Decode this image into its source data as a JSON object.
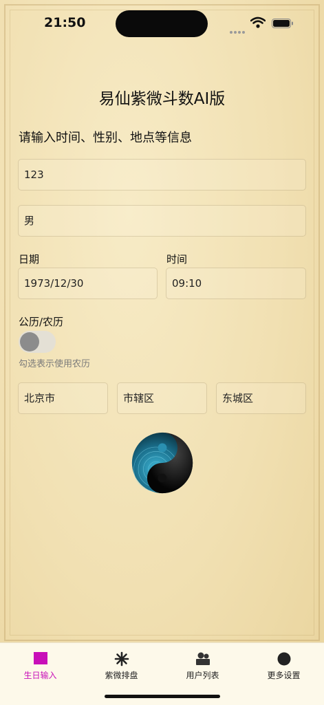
{
  "status_bar": {
    "time": "21:50"
  },
  "header": {
    "title": "易仙紫微斗数AI版"
  },
  "form": {
    "prompt": "请输入时间、性别、地点等信息",
    "name_value": "123",
    "gender_value": "男",
    "date_label": "日期",
    "date_value": "1973/12/30",
    "time_label": "时间",
    "time_value": "09:10",
    "calendar_label": "公历/农历",
    "calendar_toggle_on": false,
    "calendar_hint": "勾选表示使用农历",
    "province_value": "北京市",
    "city_value": "市辖区",
    "district_value": "东城区"
  },
  "bottom_nav": {
    "items": [
      {
        "label": "生日输入",
        "icon": "square-icon",
        "active": true
      },
      {
        "label": "紫微排盘",
        "icon": "asterisk-icon",
        "active": false
      },
      {
        "label": "用户列表",
        "icon": "users-icon",
        "active": false
      },
      {
        "label": "更多设置",
        "icon": "circle-icon",
        "active": false
      }
    ]
  },
  "colors": {
    "accent": "#c80fb8",
    "background": "#f1e0b2"
  }
}
